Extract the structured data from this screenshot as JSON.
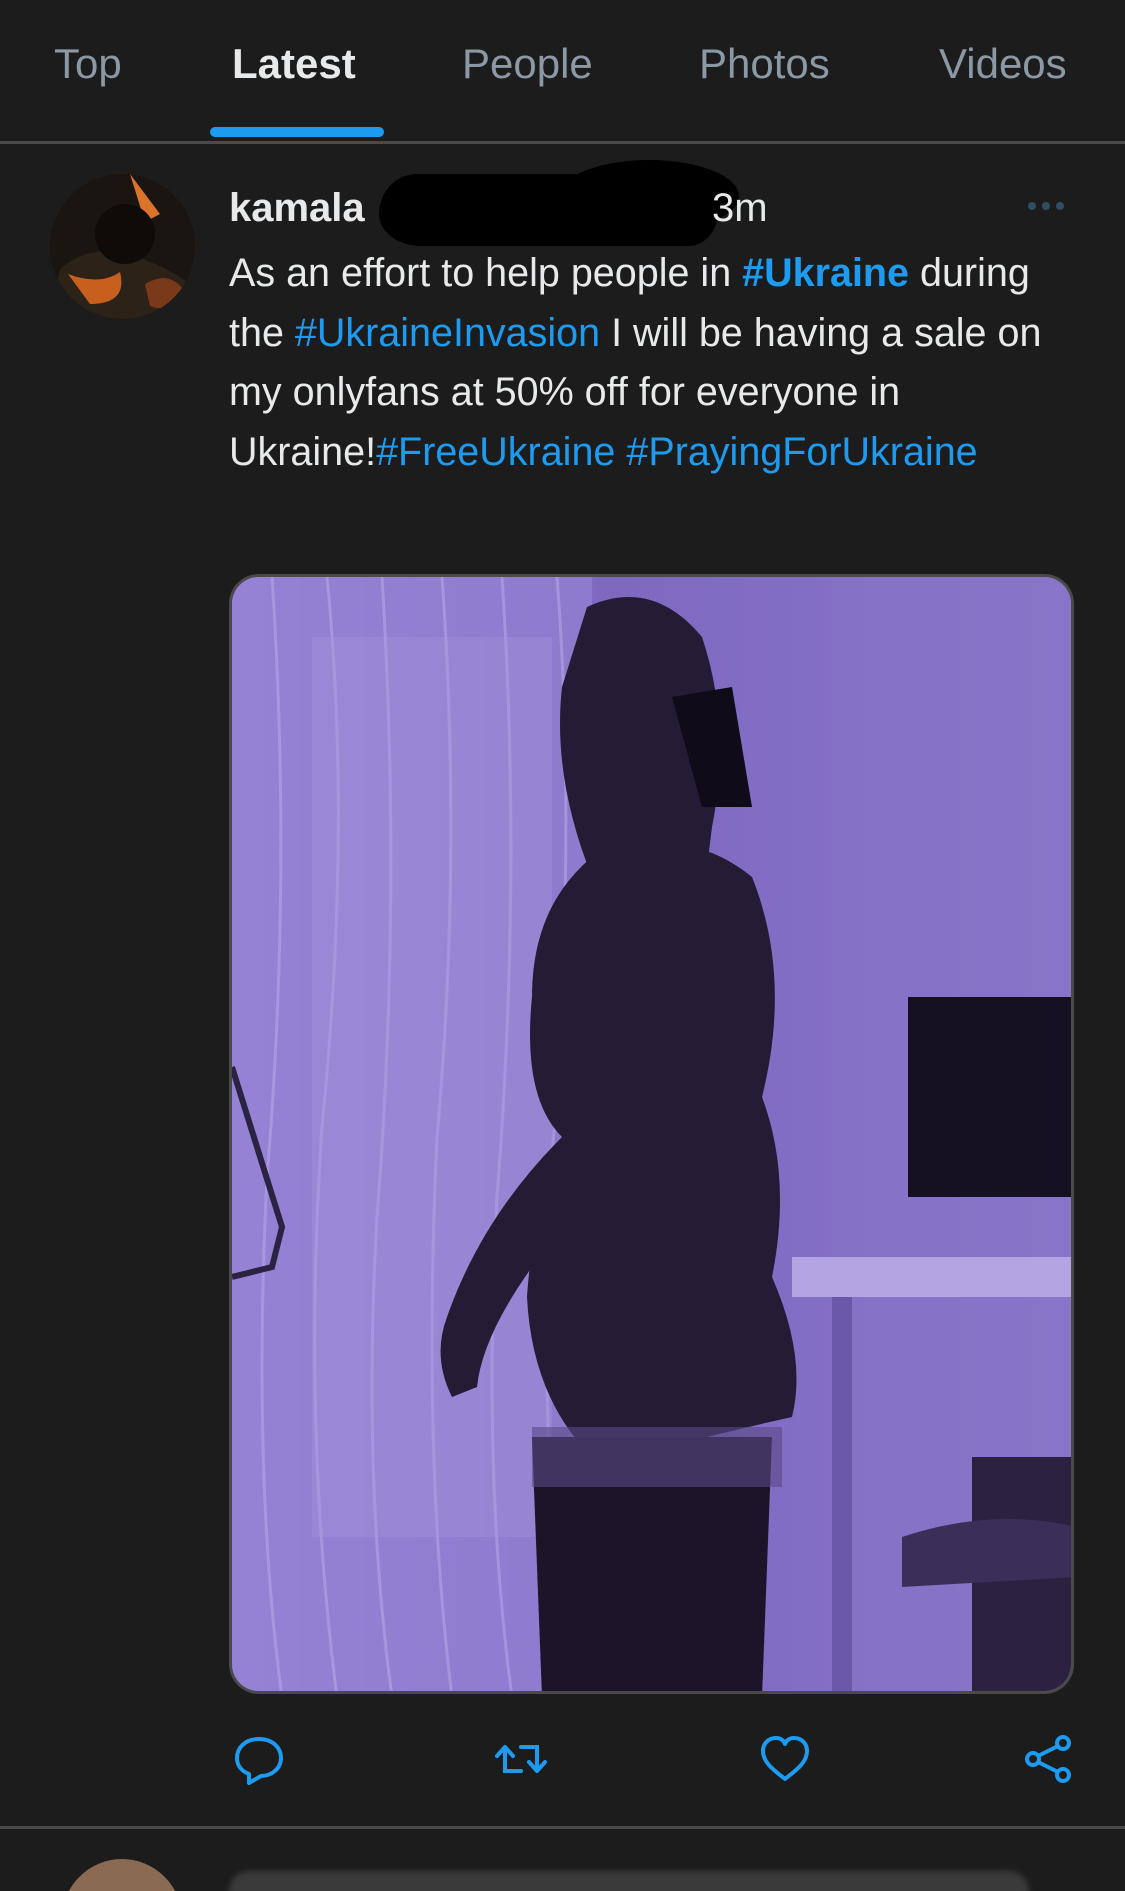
{
  "tabs": [
    {
      "label": "Top",
      "active": false
    },
    {
      "label": "Latest",
      "active": true
    },
    {
      "label": "People",
      "active": false
    },
    {
      "label": "Photos",
      "active": false
    },
    {
      "label": "Videos",
      "active": false
    }
  ],
  "tweet": {
    "author_name": "kamala",
    "timestamp": "3m",
    "text_segments": [
      {
        "text": "As an effort to help people in ",
        "type": "plain"
      },
      {
        "text": "#Ukraine",
        "type": "hashtag-bold"
      },
      {
        "text": " during the ",
        "type": "plain"
      },
      {
        "text": "#UkraineInvasion",
        "type": "hashtag"
      },
      {
        "text": " I will be having a sale on my onlyfans at 50% off for everyone in Ukraine!",
        "type": "plain"
      },
      {
        "text": "#FreeUkraine",
        "type": "hashtag"
      },
      {
        "text": " ",
        "type": "plain"
      },
      {
        "text": "#PrayingForUkraine",
        "type": "hashtag"
      }
    ],
    "icons": {
      "more": "more-horizontal-icon",
      "reply": "reply-bubble-icon",
      "retweet": "retweet-icon",
      "like": "heart-icon",
      "share": "share-icon"
    }
  },
  "colors": {
    "background": "#1c1c1c",
    "text": "#e7e9ea",
    "muted": "#8b98a5",
    "accent": "#1d9bf0",
    "media_tint": "#7b64b8"
  }
}
